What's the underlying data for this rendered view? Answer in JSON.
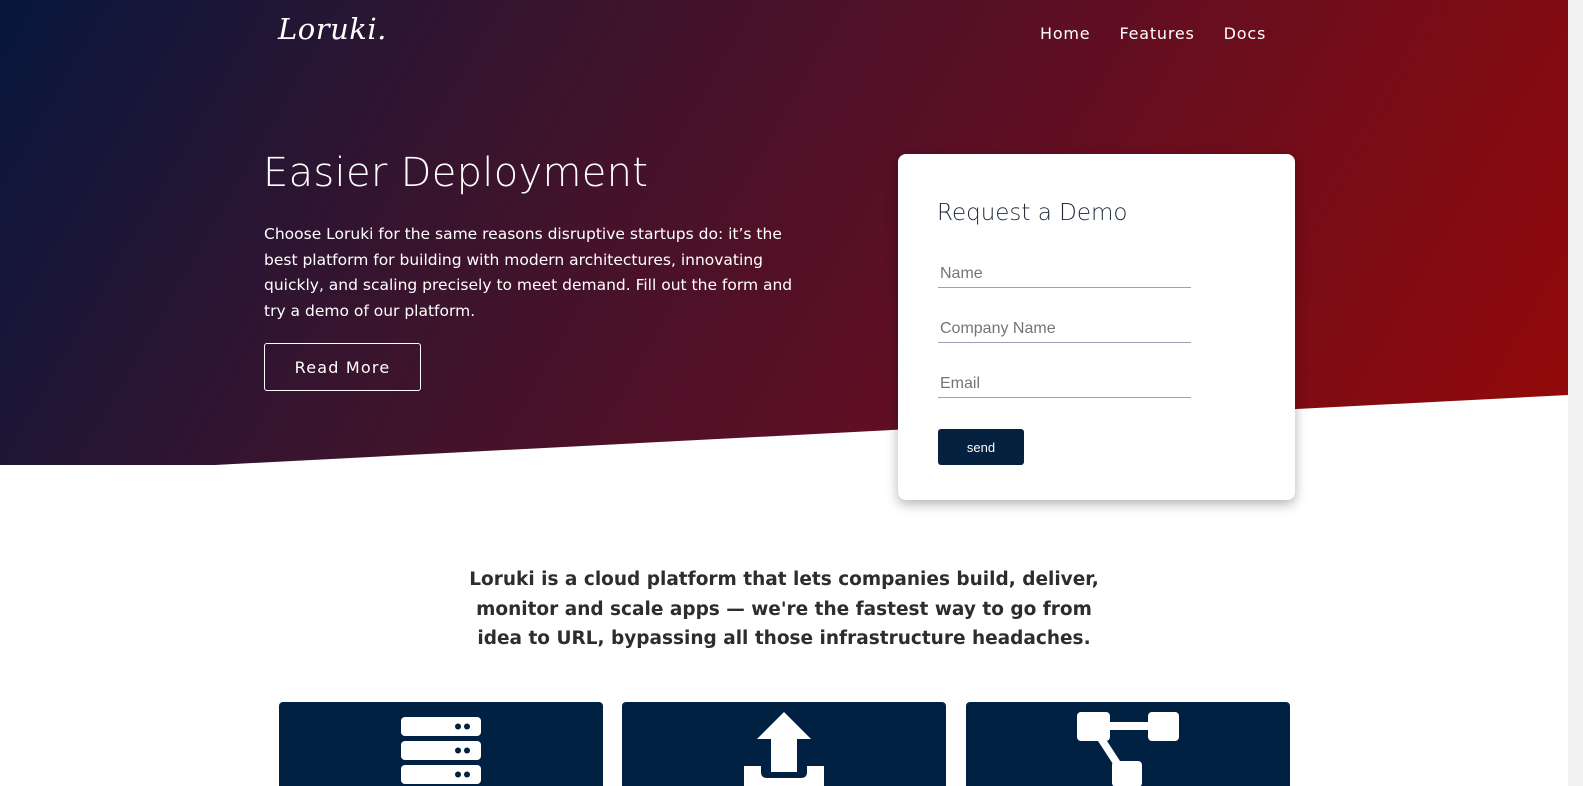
{
  "header": {
    "logo": "Loruki.",
    "nav": [
      {
        "label": "Home"
      },
      {
        "label": "Features"
      },
      {
        "label": "Docs"
      }
    ]
  },
  "hero": {
    "title": "Easier Deployment",
    "description": "Choose Loruki for the same reasons disruptive startups do: it’s the best platform for building with modern architectures, innovating quickly, and scaling precisely to meet demand. Fill out the form and try a demo of our platform.",
    "button_label": "Read More"
  },
  "demo_form": {
    "title": "Request a Demo",
    "fields": {
      "name_placeholder": "Name",
      "company_placeholder": "Company Name",
      "email_placeholder": "Email"
    },
    "submit_label": "send"
  },
  "tagline": "Loruki is a cloud platform that lets companies build, deliver, monitor and scale apps — we're the fastest way to go from idea to URL, bypassing all those infrastructure headaches.",
  "features": [
    {
      "icon": "server-icon"
    },
    {
      "icon": "upload-icon"
    },
    {
      "icon": "network-icon"
    }
  ],
  "colors": {
    "hero_gradient_start": "#07173d",
    "hero_gradient_end": "#960909",
    "primary_dark": "#012142",
    "send_button": "#062040",
    "tagline_text": "#2d2d2d"
  }
}
